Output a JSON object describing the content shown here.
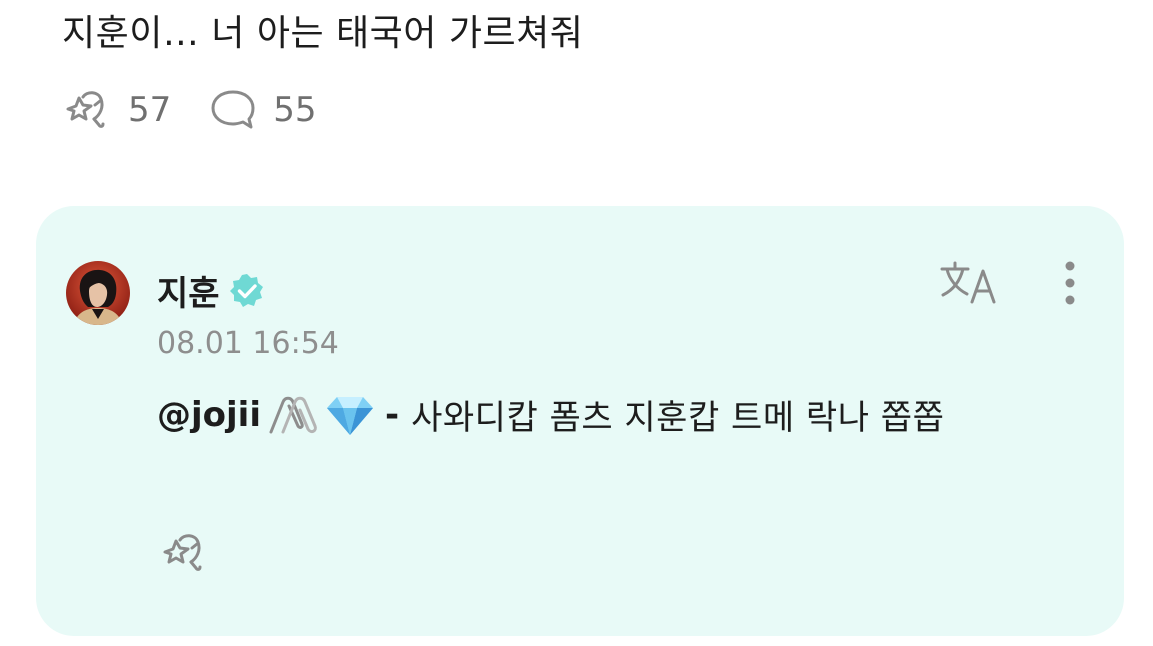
{
  "post": {
    "text": "지훈이… 너 아는 태국어 가르쳐줘",
    "like_icon": "star-hand-icon",
    "like_count": "57",
    "comment_icon": "speech-bubble-icon",
    "comment_count": "55"
  },
  "reply": {
    "author": "지훈",
    "verified_icon": "verified-badge-icon",
    "timestamp": "08.01 16:54",
    "mention": "@jojii",
    "mention_emojis": [
      "paperclip-icon",
      "gem-icon"
    ],
    "dash": "-",
    "text": "사와디캅 폼츠 지훈캅 트메 락나 쫍쫍",
    "translate_icon": "translate-icon",
    "more_icon": "more-vertical-icon",
    "like_icon": "star-hand-icon"
  },
  "colors": {
    "card_bg": "#e8faf7",
    "verified": "#6fd9d4",
    "icon_gray": "#8a8a8a",
    "text_primary": "#1d1d1d",
    "text_secondary": "#8e8e8e"
  }
}
